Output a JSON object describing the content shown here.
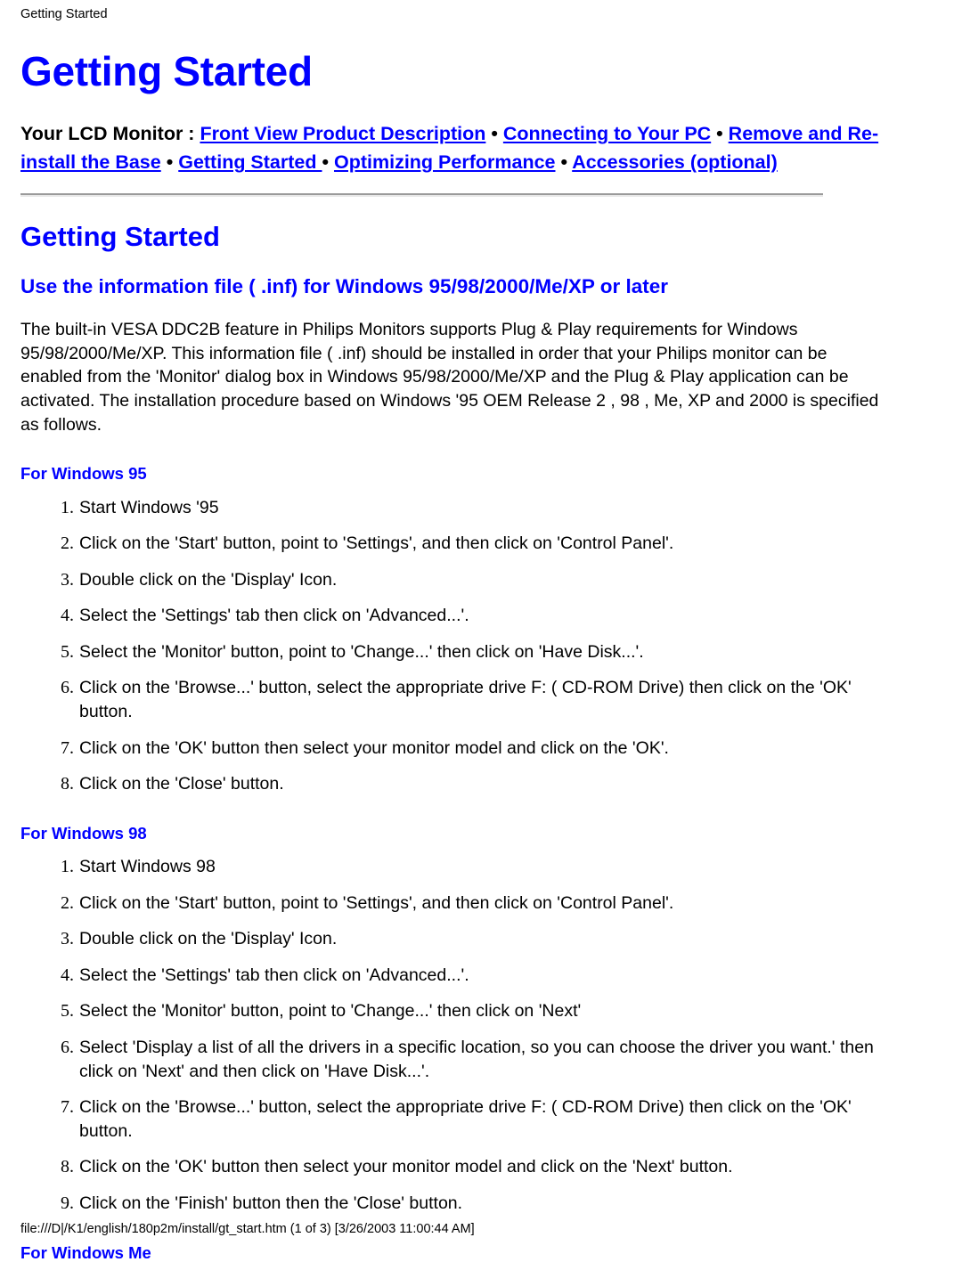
{
  "print_header": "Getting Started",
  "print_footer": "file:///D|/K1/english/180p2m/install/gt_start.htm (1 of 3) [3/26/2003 11:00:44 AM]",
  "colors": {
    "link": "#0000FF",
    "heading": "#0000FF",
    "text": "#000000",
    "background": "#FFFFFF",
    "rule_dark": "#9A9A9A",
    "rule_light": "#E8E8E8"
  },
  "doc_title": "Getting Started",
  "nav": {
    "label": "Your LCD Monitor",
    "colon": " : ",
    "separator": " • ",
    "links": [
      "Front View Product Description",
      "Connecting to Your PC",
      "Remove and Re-install the Base",
      "Getting Started ",
      "Optimizing Performance",
      "Accessories (optional)"
    ]
  },
  "section": {
    "title": "Getting Started",
    "subtitle": "Use the information file ( .inf) for Windows 95/98/2000/Me/XP or later",
    "paragraph": "The built-in VESA DDC2B feature in Philips Monitors supports Plug & Play requirements for Windows 95/98/2000/Me/XP. This information file ( .inf) should be installed in order that your Philips monitor can be enabled from the 'Monitor' dialog box in Windows 95/98/2000/Me/XP and the Plug & Play application can be activated. The installation procedure based on Windows '95 OEM Release 2 , 98 , Me, XP and 2000 is specified as follows."
  },
  "groups": [
    {
      "title": "For Windows 95",
      "steps": [
        "Start Windows '95",
        "Click on the 'Start' button, point to 'Settings', and then click on 'Control Panel'.",
        "Double click on the 'Display' Icon.",
        "Select the 'Settings' tab then click on 'Advanced...'.",
        "Select the 'Monitor' button, point to 'Change...' then click on 'Have Disk...'.",
        "Click on the 'Browse...' button, select the appropriate drive F: ( CD-ROM Drive) then click on the 'OK' button.",
        "Click on the 'OK' button then select your monitor model and click on the 'OK'.",
        "Click on the 'Close' button."
      ]
    },
    {
      "title": "For Windows 98",
      "steps": [
        "Start Windows 98",
        "Click on the 'Start' button, point to 'Settings', and then click on 'Control Panel'.",
        "Double click on the 'Display' Icon.",
        "Select the 'Settings' tab then click on 'Advanced...'.",
        "Select the 'Monitor' button, point to 'Change...' then click on 'Next'",
        "Select 'Display a list of all the drivers in a specific location, so you can choose the driver you want.' then click on 'Next' and then click on 'Have Disk...'.",
        "Click on the 'Browse...' button, select the appropriate drive F: ( CD-ROM Drive) then click on the 'OK' button.",
        "Click on the 'OK' button then select your monitor model and click on the 'Next' button.",
        "Click on the 'Finish' button then the 'Close' button."
      ]
    },
    {
      "title": "For Windows Me",
      "steps": []
    }
  ]
}
